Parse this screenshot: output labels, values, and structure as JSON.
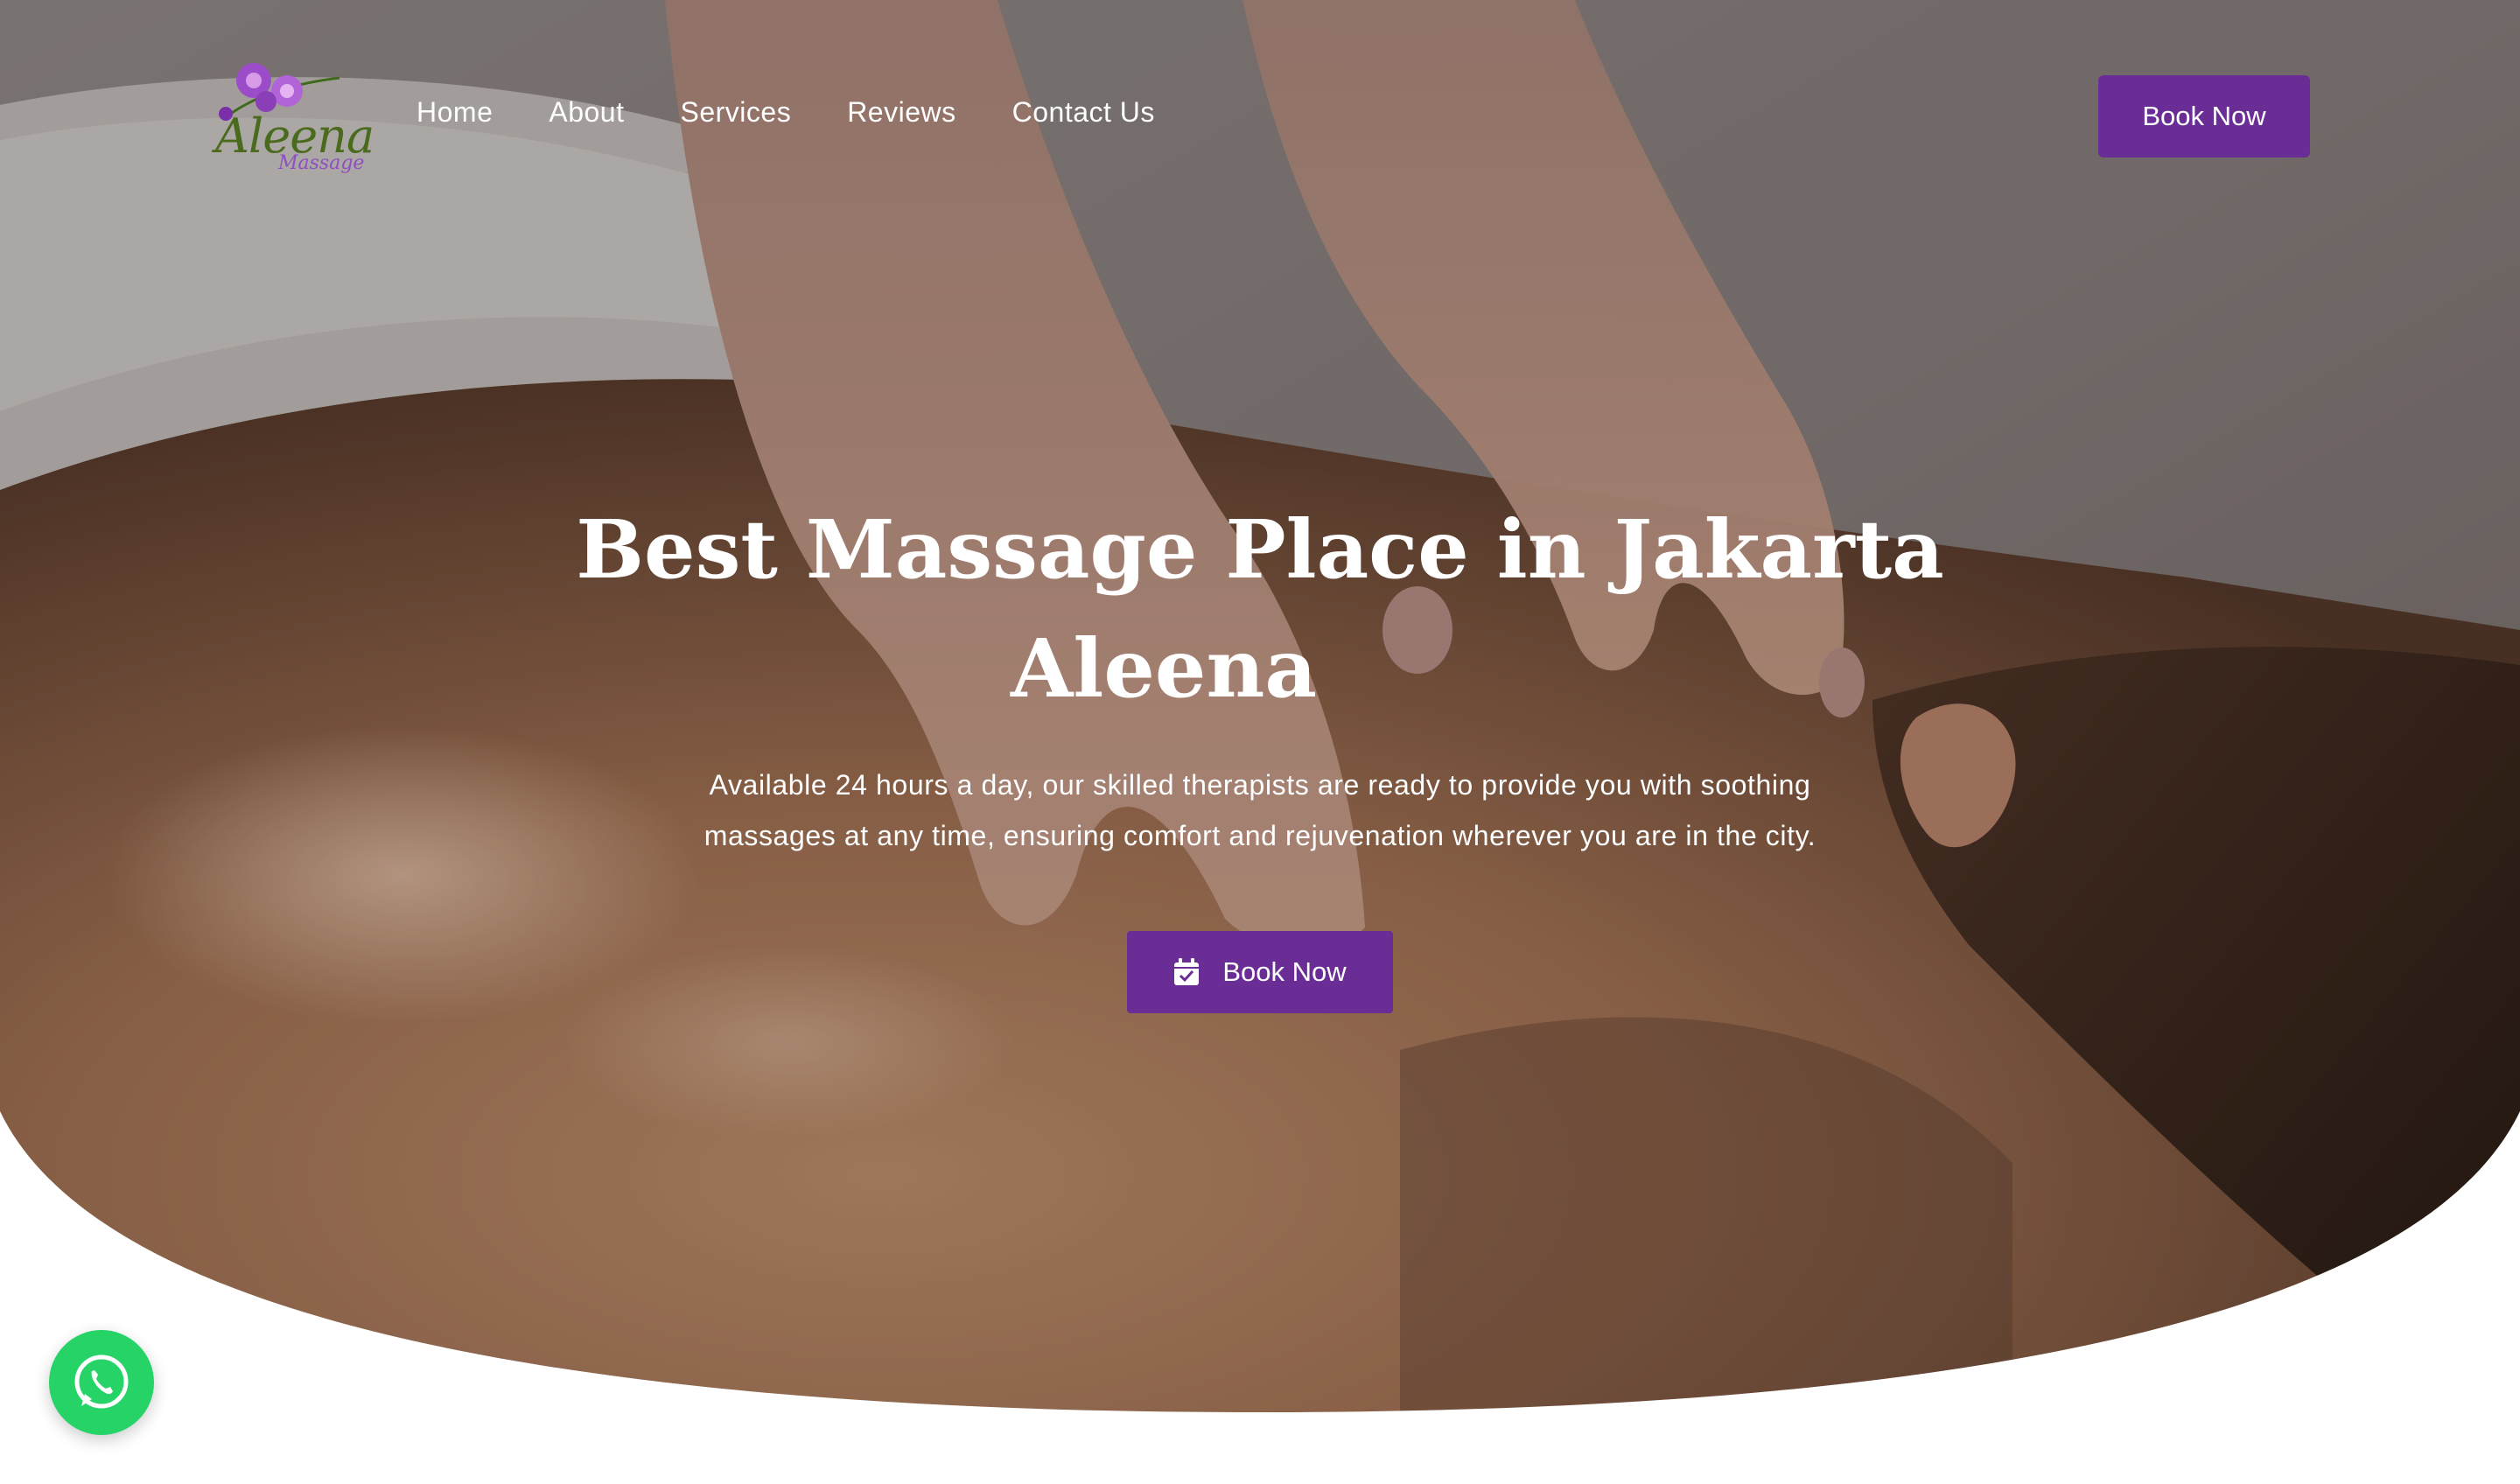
{
  "brand": {
    "logo_name": "Aleena",
    "logo_subtitle": "Massage"
  },
  "nav": {
    "items": [
      {
        "label": "Home"
      },
      {
        "label": "About"
      },
      {
        "label": "Services"
      },
      {
        "label": "Reviews"
      },
      {
        "label": "Contact Us"
      }
    ]
  },
  "header": {
    "book_label": "Book Now"
  },
  "hero": {
    "title_line1": "Best Massage Place in Jakarta",
    "title_line2": "Aleena",
    "description": "Available 24 hours a day, our skilled therapists are ready to provide you with soothing massages at any time, ensuring comfort and rejuvenation wherever you are in the city.",
    "cta_label": "Book Now",
    "cta_icon": "calendar-check-icon"
  },
  "floating": {
    "icon": "whatsapp-icon"
  },
  "colors": {
    "accent": "#6a2d96",
    "whatsapp": "#25d366",
    "logo_green": "#4a6b1e",
    "logo_purple": "#8e4fc0"
  }
}
